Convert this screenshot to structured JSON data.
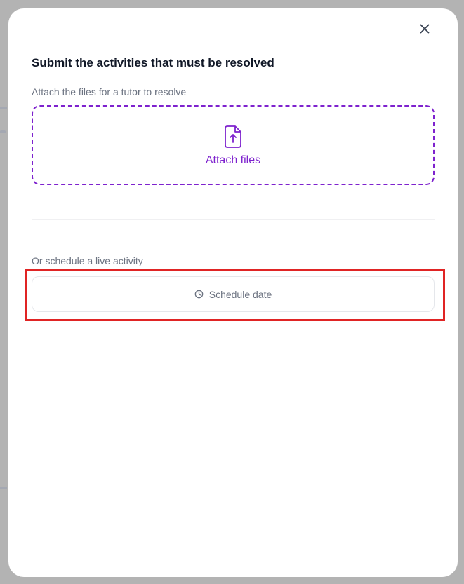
{
  "modal": {
    "title": "Submit the activities that must be resolved",
    "close_icon": "close-icon"
  },
  "attach": {
    "label": "Attach the files for a tutor to resolve",
    "button_label": "Attach files",
    "icon": "file-upload-icon",
    "accent_color": "#7e22ce"
  },
  "schedule": {
    "label": "Or schedule a live activity",
    "button_label": "Schedule date",
    "icon": "clock-icon",
    "highlight_color": "#e02424"
  }
}
